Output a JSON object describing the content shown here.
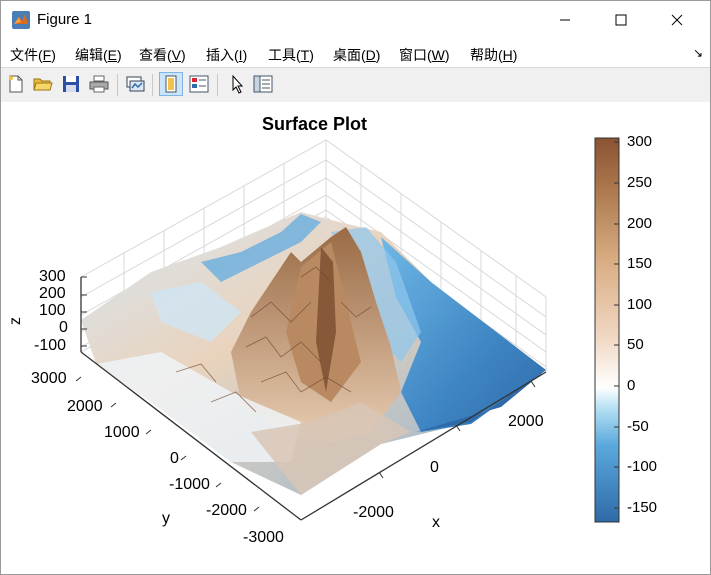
{
  "window": {
    "title": "Figure 1"
  },
  "menu": [
    {
      "label": "文件(",
      "key": "F",
      "tail": ")"
    },
    {
      "label": "编辑(",
      "key": "E",
      "tail": ")"
    },
    {
      "label": "查看(",
      "key": "V",
      "tail": ")"
    },
    {
      "label": "插入(",
      "key": "I",
      "tail": ")"
    },
    {
      "label": "工具(",
      "key": "T",
      "tail": ")"
    },
    {
      "label": "桌面(",
      "key": "D",
      "tail": ")"
    },
    {
      "label": "窗口(",
      "key": "W",
      "tail": ")"
    },
    {
      "label": "帮助(",
      "key": "H",
      "tail": ")"
    }
  ],
  "toolbar": {
    "icons": [
      "new-figure-icon",
      "open-file-icon",
      "save-icon",
      "print-icon",
      "link-plot-icon",
      "hide-plot-tools-icon",
      "show-plot-tools-icon",
      "edit-plot-icon",
      "property-inspector-icon"
    ]
  },
  "chart_data": {
    "type": "surface",
    "title": "Surface Plot",
    "xlabel": "x",
    "ylabel": "y",
    "zlabel": "z",
    "x_ticks": [
      "-2000",
      "0",
      "2000"
    ],
    "y_ticks": [
      "3000",
      "2000",
      "1000",
      "0",
      "-1000",
      "-2000",
      "-3000"
    ],
    "z_ticks": [
      "300",
      "200",
      "100",
      "0",
      "-100"
    ],
    "colorbar_ticks": [
      "300",
      "250",
      "200",
      "150",
      "100",
      "50",
      "0",
      "-50",
      "-100",
      "-150"
    ],
    "colorbar_range": [
      -165,
      305
    ],
    "colormap": [
      "#2f6aa8",
      "#5aa9dc",
      "#b9e2f4",
      "#ffffff",
      "#f0d8c3",
      "#d9ad83",
      "#b07d52",
      "#8a5232"
    ],
    "colors": {
      "accent_peak": "#8a5232",
      "accent_low": "#2f6aa8"
    }
  }
}
